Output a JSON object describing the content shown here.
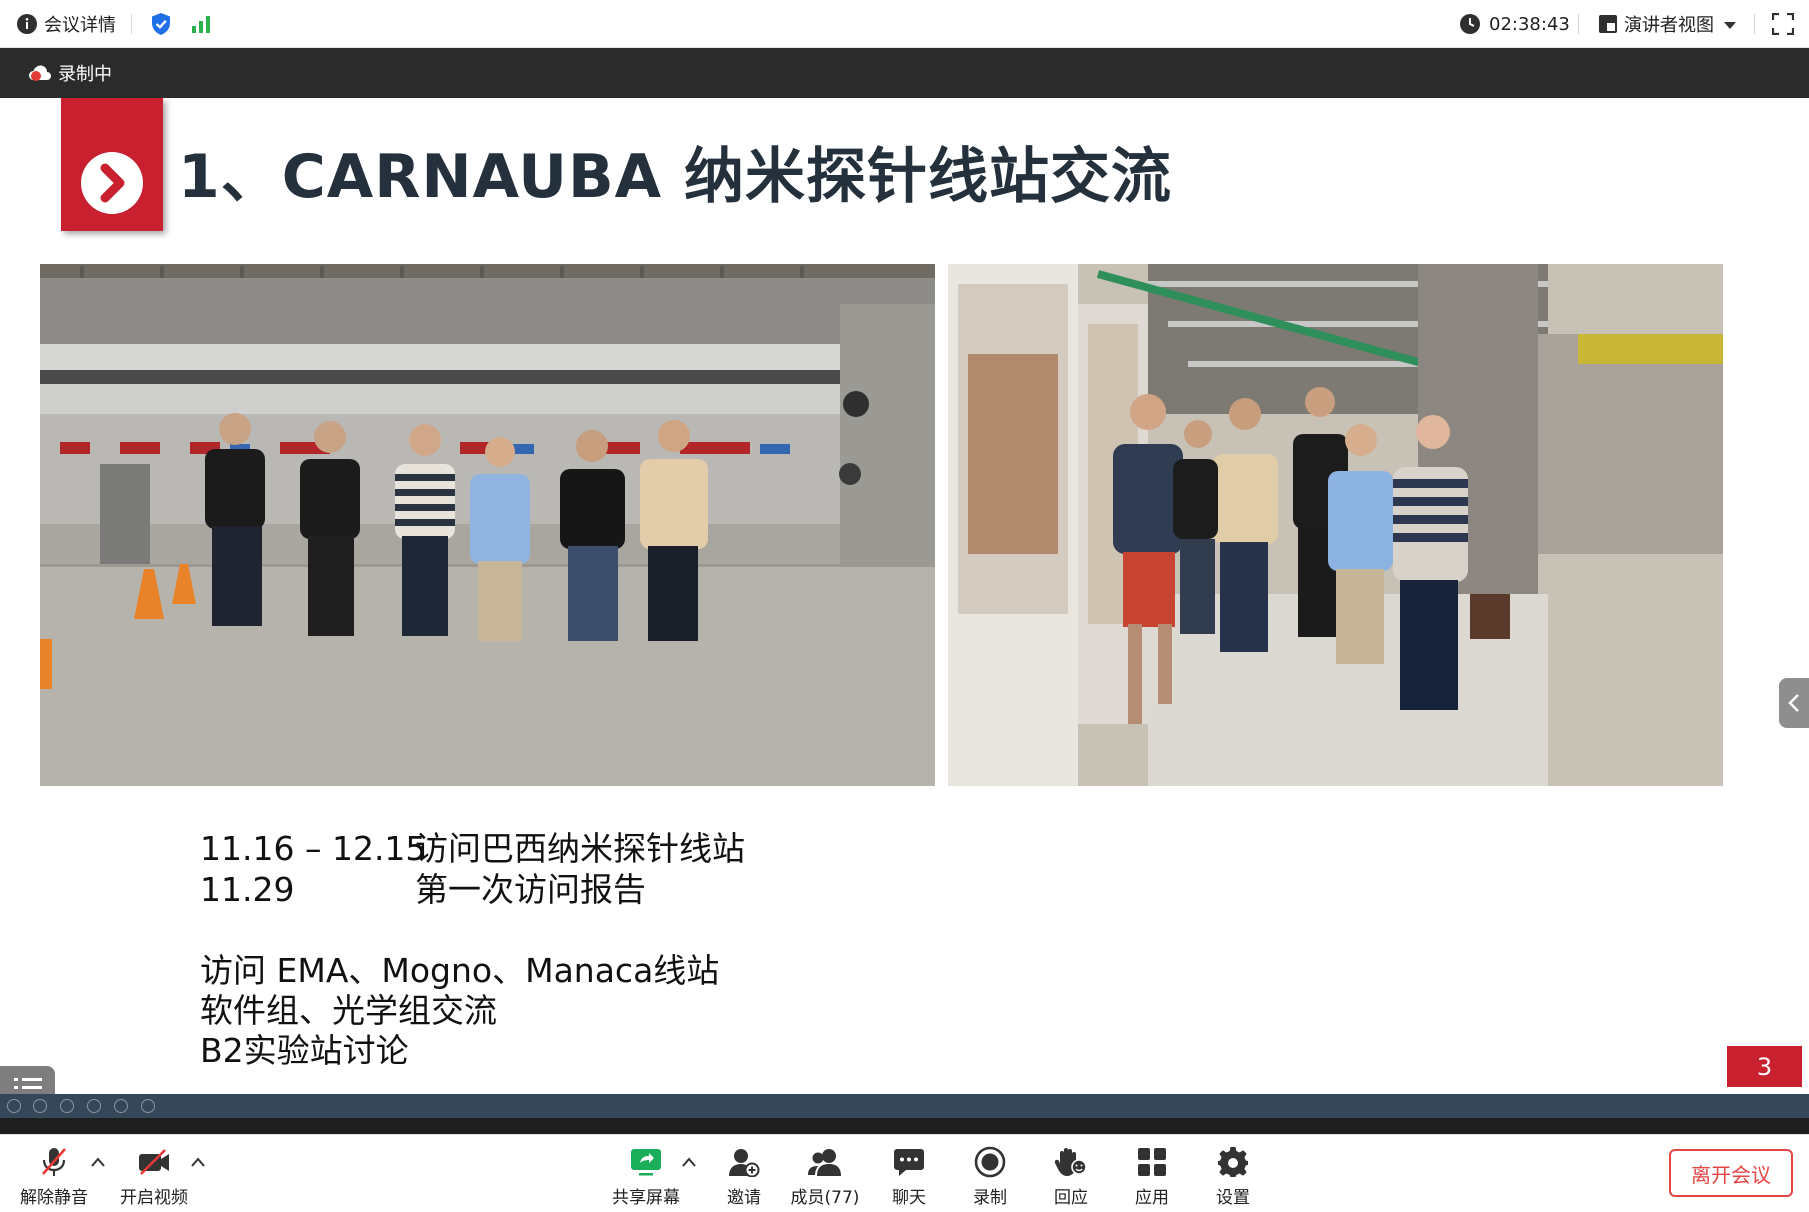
{
  "topbar": {
    "meeting_details": "会议详情",
    "timer": "02:38:43",
    "view_mode": "演讲者视图"
  },
  "recording": {
    "label": "录制中"
  },
  "slide": {
    "title": "1、CARNAUBA 纳米探针线站交流",
    "schedule": [
      {
        "date": "11.16 – 12.15",
        "event": "访问巴西纳米探针线站"
      },
      {
        "date": "11.29",
        "event": "第一次访问报告"
      }
    ],
    "notes": [
      "访问 EMA、Mogno、Manaca线站",
      "软件组、光学组交流",
      "B2实验站讨论"
    ],
    "page_number": "3"
  },
  "toolbar": {
    "unmute": "解除静音",
    "start_video": "开启视频",
    "share_screen": "共享屏幕",
    "invite": "邀请",
    "members": "成员(77)",
    "chat": "聊天",
    "record": "录制",
    "reactions": "回应",
    "apps": "应用",
    "settings": "设置",
    "leave": "离开会议"
  },
  "colors": {
    "accent_red": "#c8202f",
    "title_text": "#24303c",
    "leave_red": "#e64545",
    "share_green": "#1aad5a",
    "shield_blue": "#1e6fe8",
    "signal_green": "#2bb24c"
  }
}
